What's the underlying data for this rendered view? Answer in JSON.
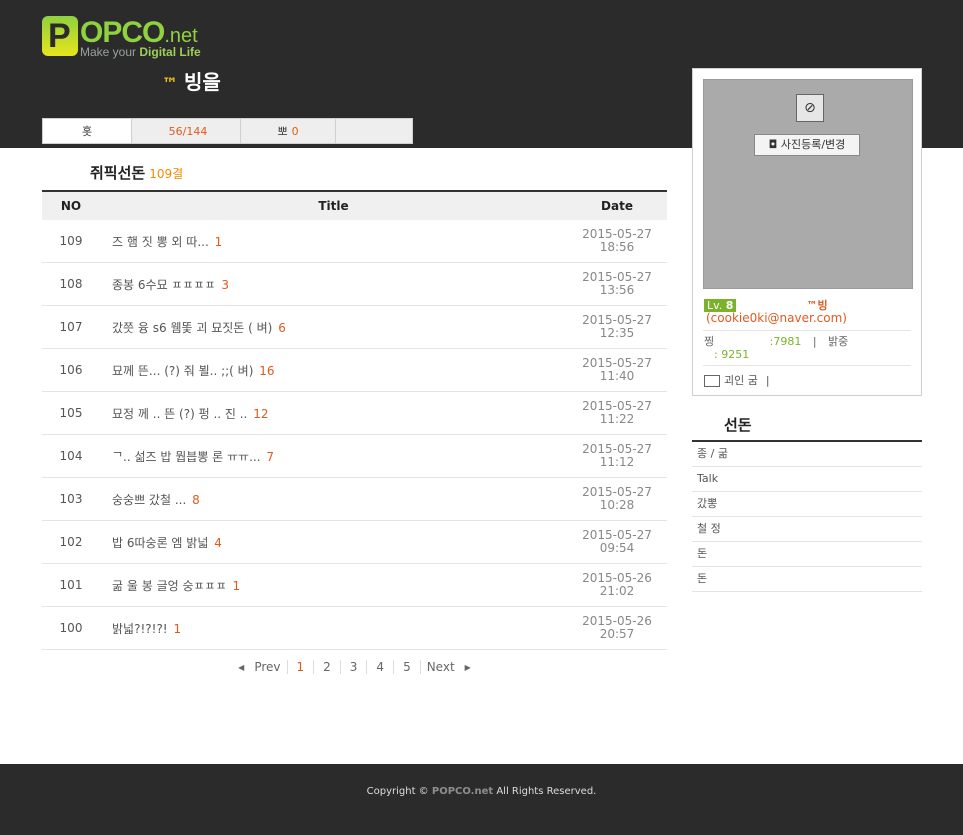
{
  "header": {
    "logo_letter": "P",
    "logo_main": "OPCO",
    "logo_suffix": ".net",
    "tagline_prefix": "Make your ",
    "tagline_bold": "Digital Life",
    "blog_tm": "™",
    "blog_name": "빙을"
  },
  "tabs": [
    {
      "label": "홋",
      "value": ""
    },
    {
      "label": "",
      "value": "56/144"
    },
    {
      "label": "뽀",
      "value": "0"
    },
    {
      "label": "",
      "value": ""
    }
  ],
  "posts_section": {
    "title": "쥐픽선돈",
    "count": "109결"
  },
  "table": {
    "headers": {
      "no": "NO",
      "title": "Title",
      "date": "Date"
    },
    "rows": [
      {
        "no": "109",
        "title": "즈 햄 짓    뽕 외 따...",
        "comments": "1",
        "date": "2015-05-27",
        "time": "18:56"
      },
      {
        "no": "108",
        "title": "종봉  6수묘    ㅍㅍㅍㅍ",
        "comments": "3",
        "date": "2015-05-27",
        "time": "13:56"
      },
      {
        "no": "107",
        "title": "갔쯧    융   s6     웸똧    괴    묘짓돈  (    벼)",
        "comments": "6",
        "date": "2015-05-27",
        "time": "12:35"
      },
      {
        "no": "106",
        "title": "묘께 뜬...    (?)    줘       뵐..   ;;(    벼)",
        "comments": "16",
        "date": "2015-05-27",
        "time": "11:40"
      },
      {
        "no": "105",
        "title": "묘정      께    .. 뜬   (?)  펑  .. 진  ..",
        "comments": "12",
        "date": "2015-05-27",
        "time": "11:22"
      },
      {
        "no": "104",
        "title": "    ᄀ..   섦즈  밥     뭡븝뽕          론    ㅠㅠ...",
        "comments": "7",
        "date": "2015-05-27",
        "time": "11:12"
      },
      {
        "no": "103",
        "title": "  숭숭쁘           갔철   ...",
        "comments": "8",
        "date": "2015-05-27",
        "time": "10:28"
      },
      {
        "no": "102",
        "title": "  밥  6따숭론  엠  밝넓",
        "comments": "4",
        "date": "2015-05-27",
        "time": "09:54"
      },
      {
        "no": "101",
        "title": "   굶    울    봉    글엉      숭ㅍㅍㅍ",
        "comments": "1",
        "date": "2015-05-26",
        "time": "21:02"
      },
      {
        "no": "100",
        "title": "밝넓?!?!?!",
        "comments": "1",
        "date": "2015-05-26",
        "time": "20:57"
      }
    ]
  },
  "pager": {
    "prev": "Prev",
    "next": "Next",
    "pages": [
      "1",
      "2",
      "3",
      "4",
      "5"
    ],
    "current": "1"
  },
  "profile": {
    "photo_button": "사진등록/변경",
    "level_label": "Lv.",
    "level_value": "8",
    "username": "™빙",
    "email": "(cookie0ki@naver.com)",
    "stat1_label": "찡",
    "stat1_value": ":7981",
    "stat1_sep": "|",
    "stat2_label": "밝중",
    "stat3_value": ": 9251",
    "card_label": "괴인  굼",
    "card_sep": "|"
  },
  "categories": {
    "title": "선돈",
    "items": [
      "종    /       굶",
      "Talk",
      "갔뽕",
      "철   정",
      "      돈",
      "돈"
    ]
  },
  "footer": {
    "copyright_prefix": "Copyright © ",
    "brand": "POPCO.net",
    "copyright_suffix": "  All Rights Reserved."
  },
  "colors": {
    "header_bg": "#2b2b2b",
    "accent_orange": "#e05a1e",
    "accent_green": "#7ab22b",
    "logo_green": "#8fd13f"
  }
}
